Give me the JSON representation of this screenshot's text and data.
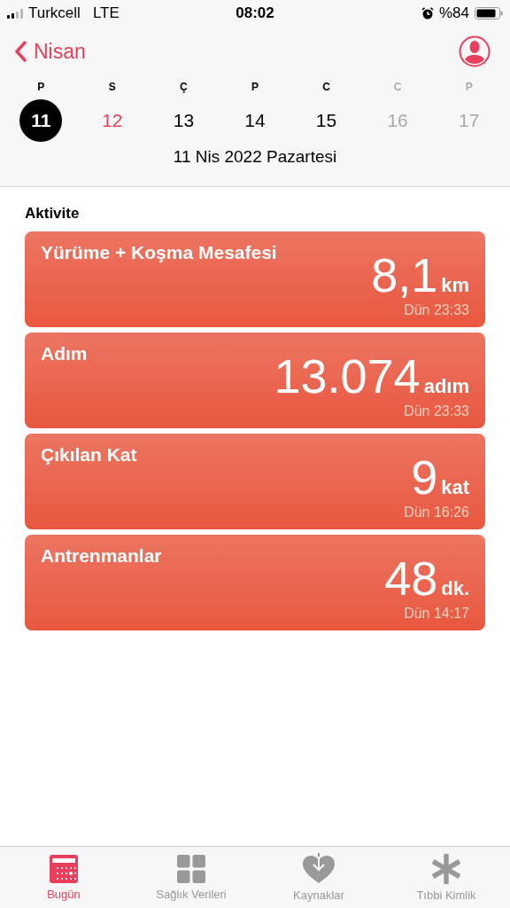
{
  "status_bar": {
    "carrier": "Turkcell",
    "network": "LTE",
    "time": "08:02",
    "battery_percent": "%84"
  },
  "nav": {
    "back_label": "Nisan"
  },
  "week": [
    {
      "weekday": "P",
      "day": "11",
      "selected": true,
      "today": false,
      "disabled": false
    },
    {
      "weekday": "S",
      "day": "12",
      "selected": false,
      "today": true,
      "disabled": false
    },
    {
      "weekday": "Ç",
      "day": "13",
      "selected": false,
      "today": false,
      "disabled": false
    },
    {
      "weekday": "P",
      "day": "14",
      "selected": false,
      "today": false,
      "disabled": false
    },
    {
      "weekday": "C",
      "day": "15",
      "selected": false,
      "today": false,
      "disabled": false
    },
    {
      "weekday": "C",
      "day": "16",
      "selected": false,
      "today": false,
      "disabled": true
    },
    {
      "weekday": "P",
      "day": "17",
      "selected": false,
      "today": false,
      "disabled": true
    }
  ],
  "date_title": "11 Nis 2022 Pazartesi",
  "section_title": "Aktivite",
  "cards": [
    {
      "title": "Yürüme + Koşma Mesafesi",
      "value": "8,1",
      "unit": "km",
      "time": "Dün 23:33"
    },
    {
      "title": "Adım",
      "value": "13.074",
      "unit": "adım",
      "time": "Dün 23:33"
    },
    {
      "title": "Çıkılan Kat",
      "value": "9",
      "unit": "kat",
      "time": "Dün 16:26"
    },
    {
      "title": "Antrenmanlar",
      "value": "48",
      "unit": "dk.",
      "time": "Dün 14:17"
    }
  ],
  "tabs": [
    {
      "label": "Bugün",
      "kind": "today",
      "selected": true
    },
    {
      "label": "Sağlık Verileri",
      "kind": "grid",
      "selected": false
    },
    {
      "label": "Kaynaklar",
      "kind": "sources",
      "selected": false
    },
    {
      "label": "Tıbbi Kimlik",
      "kind": "medical",
      "selected": false
    }
  ]
}
